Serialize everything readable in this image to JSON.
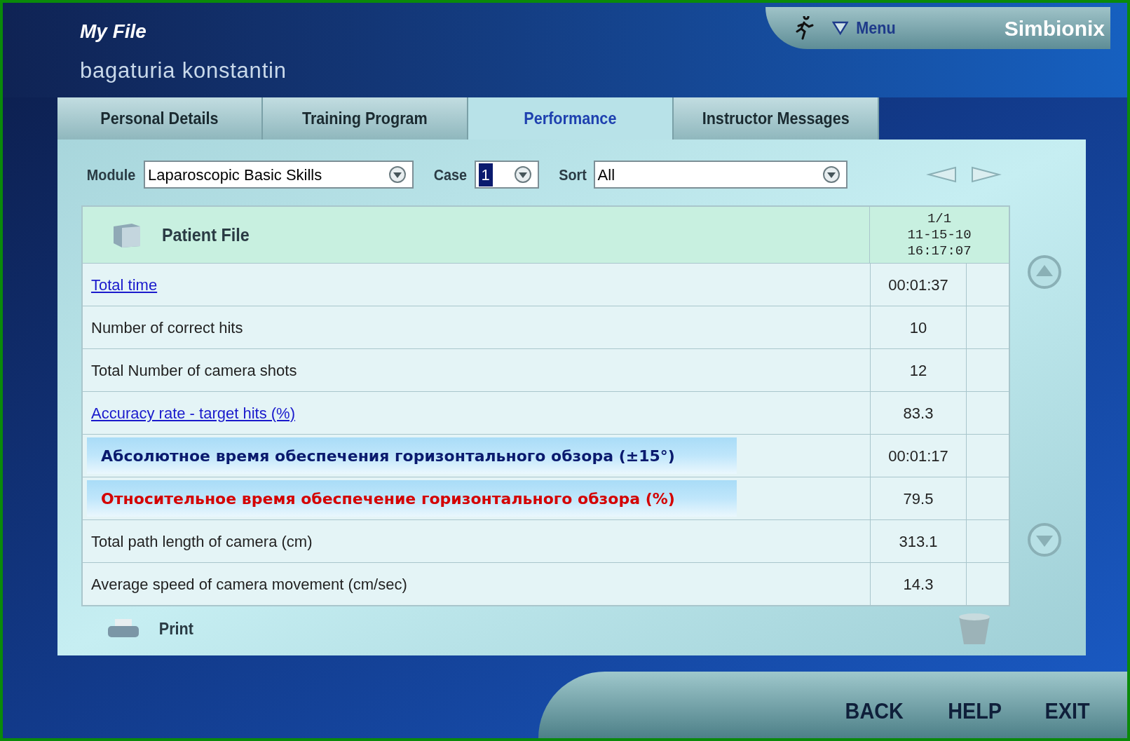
{
  "header": {
    "title": "My File",
    "user": "bagaturia konstantin",
    "menu": "Menu",
    "logo": "Simbionix"
  },
  "tabs": [
    {
      "label": "Personal Details",
      "selected": false
    },
    {
      "label": "Training Program",
      "selected": false
    },
    {
      "label": "Performance",
      "selected": true
    },
    {
      "label": "Instructor Messages",
      "selected": false
    }
  ],
  "filters": [
    {
      "label": "Module",
      "value": "Laparoscopic Basic Skills",
      "kind": "wide"
    },
    {
      "label": "Case",
      "value": "1",
      "kind": "narrow"
    },
    {
      "label": "Sort",
      "value": "All",
      "kind": "wide"
    }
  ],
  "table": {
    "title": "Patient File",
    "session": [
      "1/1",
      "11-15-10",
      "16:17:07"
    ],
    "rows": [
      {
        "label": "Total time",
        "value": "00:01:37",
        "kind": "link"
      },
      {
        "label": "Number of correct hits",
        "value": "10",
        "kind": "plain"
      },
      {
        "label": "Total Number of camera shots",
        "value": "12",
        "kind": "plain"
      },
      {
        "label": "Accuracy rate - target hits (%)",
        "value": "83.3",
        "kind": "link"
      },
      {
        "label": "Абсолютное время обеспечения горизонтального обзора (±15°)",
        "value": "00:01:17",
        "kind": "highlight",
        "color": "#0a1a6e"
      },
      {
        "label": "Относительное время обеспечение горизонтального обзора (%)",
        "value": "79.5",
        "kind": "highlight",
        "color": "#d40000"
      },
      {
        "label": "Total path length of camera (cm)",
        "value": "313.1",
        "kind": "plain"
      },
      {
        "label": "Average speed of camera movement (cm/sec)",
        "value": "14.3",
        "kind": "plain"
      }
    ]
  },
  "print": "Print",
  "nav": [
    "BACK",
    "HELP",
    "EXIT"
  ]
}
